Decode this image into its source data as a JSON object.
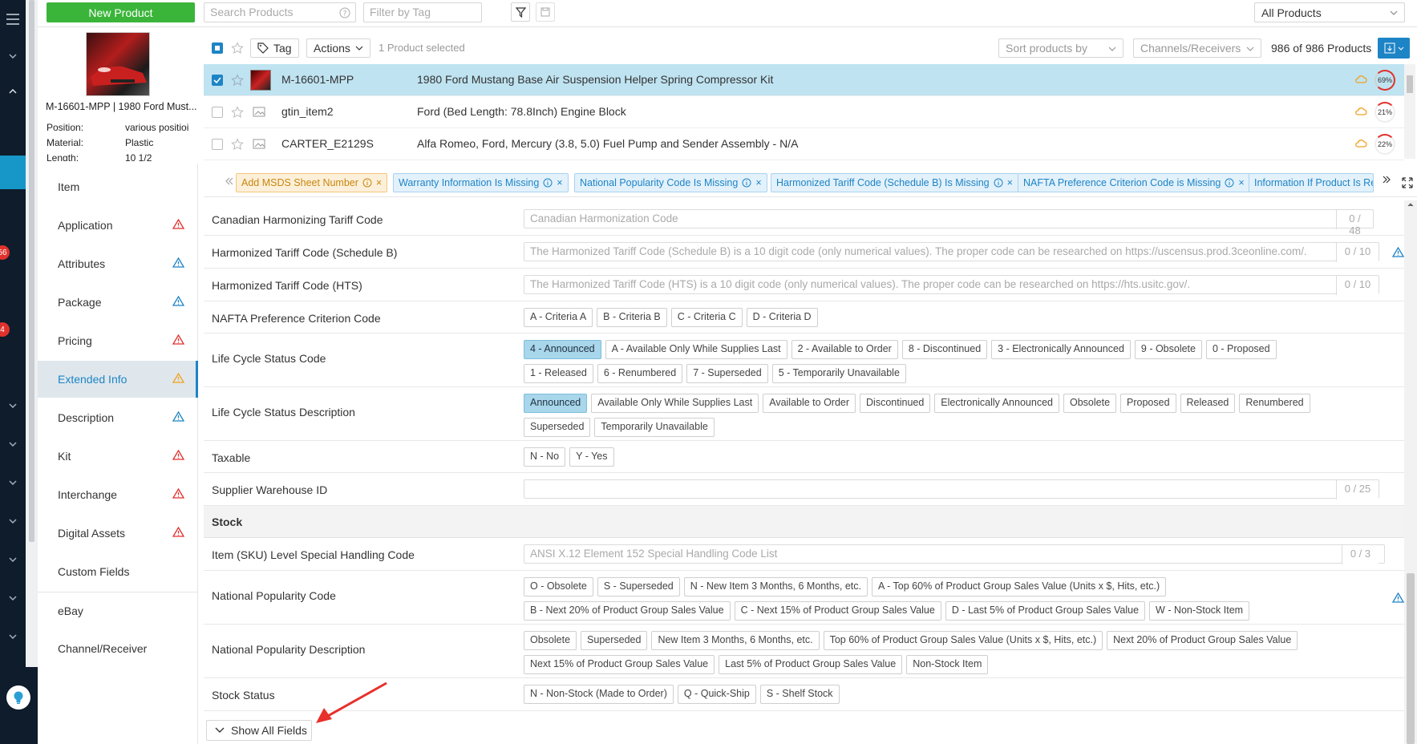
{
  "topbar": {
    "new_product_label": "New Product",
    "search_placeholder": "Search Products",
    "tag_filter_placeholder": "Filter by Tag",
    "scope_select_value": "All Products"
  },
  "rail": {
    "badges": [
      "56",
      "4"
    ]
  },
  "preview": {
    "title": "M-16601-MPP | 1980 Ford Must...",
    "fields": [
      {
        "label": "Position:",
        "value": "various positioi"
      },
      {
        "label": "Material:",
        "value": "Plastic"
      },
      {
        "label": "Length:",
        "value": "10 1/2"
      }
    ]
  },
  "toolbar": {
    "tag_label": "Tag",
    "actions_label": "Actions",
    "selected_text": "1 Product selected",
    "sort_placeholder": "Sort products by",
    "channels_placeholder": "Channels/Receivers",
    "count_text": "986 of 986 Products"
  },
  "products": [
    {
      "sku": "M-16601-MPP",
      "name": "1980 Ford Mustang Base Air Suspension Helper Spring Compressor Kit",
      "progress": "69%",
      "progress_value": 69,
      "selected": true
    },
    {
      "sku": "gtin_item2",
      "name": "Ford (Bed Length: 78.8Inch) Engine Block",
      "progress": "21%",
      "progress_value": 21,
      "selected": false
    },
    {
      "sku": "CARTER_E2129S",
      "name": "Alfa Romeo, Ford, Mercury (3.8, 5.0) Fuel Pump and Sender Assembly - N/A",
      "progress": "22%",
      "progress_value": 22,
      "selected": false
    }
  ],
  "nav": [
    {
      "label": "Item",
      "warn": ""
    },
    {
      "label": "Application",
      "warn": "red"
    },
    {
      "label": "Attributes",
      "warn": "blue"
    },
    {
      "label": "Package",
      "warn": "blue"
    },
    {
      "label": "Pricing",
      "warn": "red"
    },
    {
      "label": "Extended Info",
      "warn": "orange",
      "active": true
    },
    {
      "label": "Description",
      "warn": "blue"
    },
    {
      "label": "Kit",
      "warn": "red"
    },
    {
      "label": "Interchange",
      "warn": "red"
    },
    {
      "label": "Digital Assets",
      "warn": "red"
    },
    {
      "label": "Custom Fields",
      "warn": ""
    },
    {
      "label": "eBay",
      "warn": ""
    },
    {
      "label": "Channel/Receiver",
      "warn": ""
    }
  ],
  "chips": [
    {
      "label": "Add MSDS Sheet Number",
      "tone": "orange"
    },
    {
      "label": "Warranty Information Is Missing",
      "tone": "blue"
    },
    {
      "label": "National Popularity Code Is Missing",
      "tone": "blue"
    },
    {
      "label": "Harmonized Tariff Code (Schedule B) Is Missing",
      "tone": "blue"
    },
    {
      "label": "NAFTA Preference Criterion Code is Missing",
      "tone": "blue"
    },
    {
      "label": "Information If Product Is Re",
      "tone": "blue"
    }
  ],
  "form": {
    "canadian_label": "Canadian Harmonizing Tariff Code",
    "canadian_placeholder": "Canadian Harmonization Code",
    "canadian_count": "0 / 48",
    "schedb_label": "Harmonized Tariff Code (Schedule B)",
    "schedb_placeholder": "The Harmonized Tariff Code (Schedule B) is a 10 digit code (only numerical values). The proper code can be researched on https://uscensus.prod.3ceonline.com/.",
    "schedb_count": "0 / 10",
    "hts_label": "Harmonized Tariff Code (HTS)",
    "hts_placeholder": "The Harmonized Tariff Code (HTS) is a 10 digit code (only numerical values). The proper code can be researched on https://hts.usitc.gov/.",
    "hts_count": "0 / 10",
    "nafta_label": "NAFTA Preference Criterion Code",
    "nafta_options": [
      "A - Criteria A",
      "B - Criteria B",
      "C - Criteria C",
      "D - Criteria D"
    ],
    "lcs_code_label": "Life Cycle Status Code",
    "lcs_code_options": [
      "4 - Announced",
      "A - Available Only While Supplies Last",
      "2 - Available to Order",
      "8 - Discontinued",
      "3 - Electronically Announced",
      "9 - Obsolete",
      "0 - Proposed",
      "1 - Released",
      "6 - Renumbered",
      "7 - Superseded",
      "5 - Temporarily Unavailable"
    ],
    "lcs_desc_label": "Life Cycle Status Description",
    "lcs_desc_options": [
      "Announced",
      "Available Only While Supplies Last",
      "Available to Order",
      "Discontinued",
      "Electronically Announced",
      "Obsolete",
      "Proposed",
      "Released",
      "Renumbered",
      "Superseded",
      "Temporarily Unavailable"
    ],
    "taxable_label": "Taxable",
    "taxable_options": [
      "N - No",
      "Y - Yes"
    ],
    "warehouse_label": "Supplier Warehouse ID",
    "warehouse_count": "0 / 25",
    "stock_section": "Stock",
    "sku_handling_label": "Item (SKU) Level Special Handling Code",
    "sku_handling_placeholder": "ANSI X.12 Element 152 Special Handling Code List",
    "sku_handling_count": "0 / 3",
    "npc_label": "National Popularity Code",
    "npc_options": [
      "O - Obsolete",
      "S - Superseded",
      "N - New Item 3 Months, 6 Months, etc.",
      "A - Top 60% of Product Group Sales Value (Units x $, Hits, etc.)",
      "B - Next 20% of Product Group Sales Value",
      "C - Next 15% of Product Group Sales Value",
      "D - Last 5% of Product Group Sales Value",
      "W - Non-Stock Item"
    ],
    "npd_label": "National Popularity Description",
    "npd_options": [
      "Obsolete",
      "Superseded",
      "New Item 3 Months, 6 Months, etc.",
      "Top 60% of Product Group Sales Value (Units x $, Hits, etc.)",
      "Next 20% of Product Group Sales Value",
      "Next 15% of Product Group Sales Value",
      "Last 5% of Product Group Sales Value",
      "Non-Stock Item"
    ],
    "stock_status_label": "Stock Status",
    "stock_status_options": [
      "N - Non-Stock (Made to Order)",
      "Q - Quick-Ship",
      "S - Shelf Stock"
    ],
    "show_all_label": "Show All Fields"
  },
  "colors": {
    "accent": "#1d84c6",
    "new_button": "#3ab53a",
    "selected_row": "#bfe3f1",
    "warn_red": "#e0322d",
    "warn_blue": "#1d84c6",
    "warn_orange": "#f0a020",
    "arrow": "#e8302a"
  }
}
